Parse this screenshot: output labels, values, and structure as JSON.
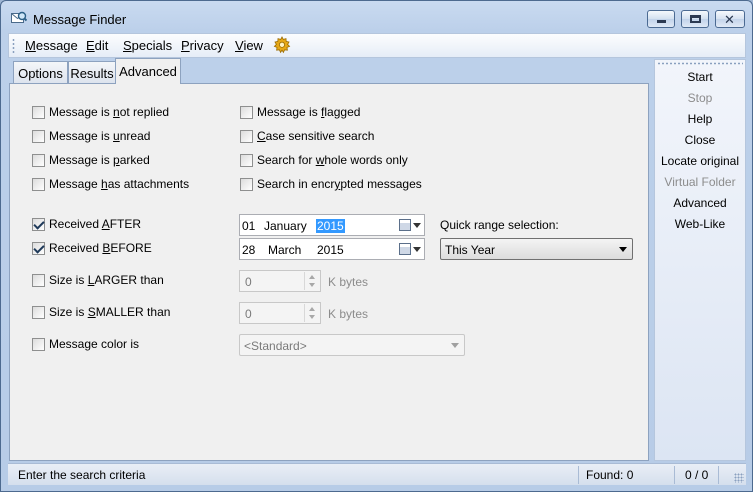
{
  "window": {
    "title": "Message Finder"
  },
  "menu": {
    "message": {
      "key": "M",
      "rest": "essage"
    },
    "edit": {
      "key": "E",
      "rest": "dit"
    },
    "specials": {
      "key": "S",
      "rest": "pecials"
    },
    "privacy": {
      "key": "P",
      "rest": "rivacy"
    },
    "view": {
      "key": "V",
      "rest": "iew"
    }
  },
  "tabs": {
    "options": "Options",
    "results": "Results",
    "advanced": "Advanced"
  },
  "checks": {
    "not_replied": {
      "pre": "Message is ",
      "key": "n",
      "post": "ot replied",
      "checked": false
    },
    "flagged": {
      "pre": "Message is ",
      "key": "f",
      "post": "lagged",
      "checked": false
    },
    "unread": {
      "pre": "Message is ",
      "key": "u",
      "post": "nread",
      "checked": false
    },
    "case_sensitive": {
      "pre": "",
      "key": "C",
      "post": "ase sensitive search",
      "checked": false
    },
    "parked": {
      "pre": "Message is ",
      "key": "p",
      "post": "arked",
      "checked": false
    },
    "whole_words": {
      "pre": "Search for ",
      "key": "w",
      "post": "hole words only",
      "checked": false
    },
    "attachments": {
      "pre": "Message ",
      "key": "h",
      "post": "as attachments",
      "checked": false
    },
    "encrypted": {
      "pre": "Search in encr",
      "key": "y",
      "post": "pted messages",
      "checked": false
    },
    "received_after": {
      "pre": "Received ",
      "key": "A",
      "post": "FTER",
      "checked": true
    },
    "received_before": {
      "pre": "Received ",
      "key": "B",
      "post": "EFORE",
      "checked": true
    },
    "larger": {
      "pre": "Size is ",
      "key": "L",
      "post": "ARGER than",
      "checked": false
    },
    "smaller": {
      "pre": "Size is ",
      "key": "S",
      "post": "MALLER than",
      "checked": false
    },
    "color": {
      "pre": "Message color is",
      "key": "",
      "post": "",
      "checked": false
    }
  },
  "after_date": {
    "day": "01",
    "month": "January",
    "year": "2015"
  },
  "before_date": {
    "day": "28",
    "month": "March",
    "year": "2015"
  },
  "quick_range": {
    "label": "Quick range selection:",
    "value": "This Year"
  },
  "size_larger": {
    "value": "0",
    "unit": "K bytes"
  },
  "size_smaller": {
    "value": "0",
    "unit": "K bytes"
  },
  "color_select": {
    "value": "<Standard>"
  },
  "side_buttons": {
    "start": "Start",
    "stop": "Stop",
    "help": "Help",
    "close": "Close",
    "locate": "Locate original",
    "virtual": "Virtual Folder",
    "advanced": "Advanced",
    "weblike": "Web-Like"
  },
  "status": {
    "message": "Enter the search criteria",
    "found": "Found: 0",
    "position": "0 / 0"
  }
}
